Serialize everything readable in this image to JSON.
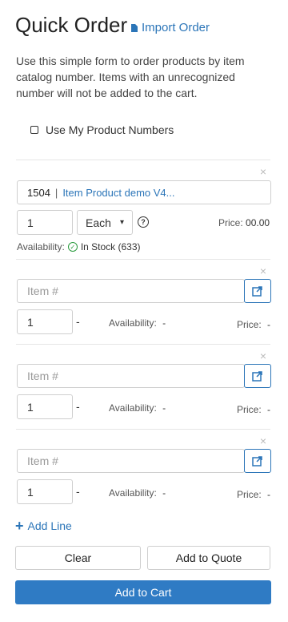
{
  "page_title": "Quick Order",
  "import_label": "Import Order",
  "description": "Use this simple form to order products by item catalog number. Items with an unrecognized number will not be added to the cart.",
  "use_my_product_numbers_label": "Use My Product Numbers",
  "first_item": {
    "item_number": "1504",
    "item_separator": "|",
    "item_name": "Item Product demo V4...",
    "quantity": "1",
    "unit": "Each",
    "unit_caret": "▾",
    "help_icon": "?",
    "price_label": "Price:",
    "price_value": "00.00",
    "availability_label": "Availability:",
    "availability_value": "In Stock (633)"
  },
  "empty_row_template": {
    "item_placeholder": "Item #",
    "quantity": "1",
    "unit_dash": "-",
    "availability_label": "Availability:",
    "availability_value": "-",
    "price_label": "Price:",
    "price_value": "-"
  },
  "remove_glyph": "×",
  "add_line_label": "Add Line",
  "buttons": {
    "clear": "Clear",
    "add_to_quote": "Add to Quote",
    "add_to_cart": "Add to Cart"
  },
  "colors": {
    "accent": "#2b75b8",
    "primary_button": "#2f7bc4",
    "in_stock": "#2a9b3e"
  }
}
